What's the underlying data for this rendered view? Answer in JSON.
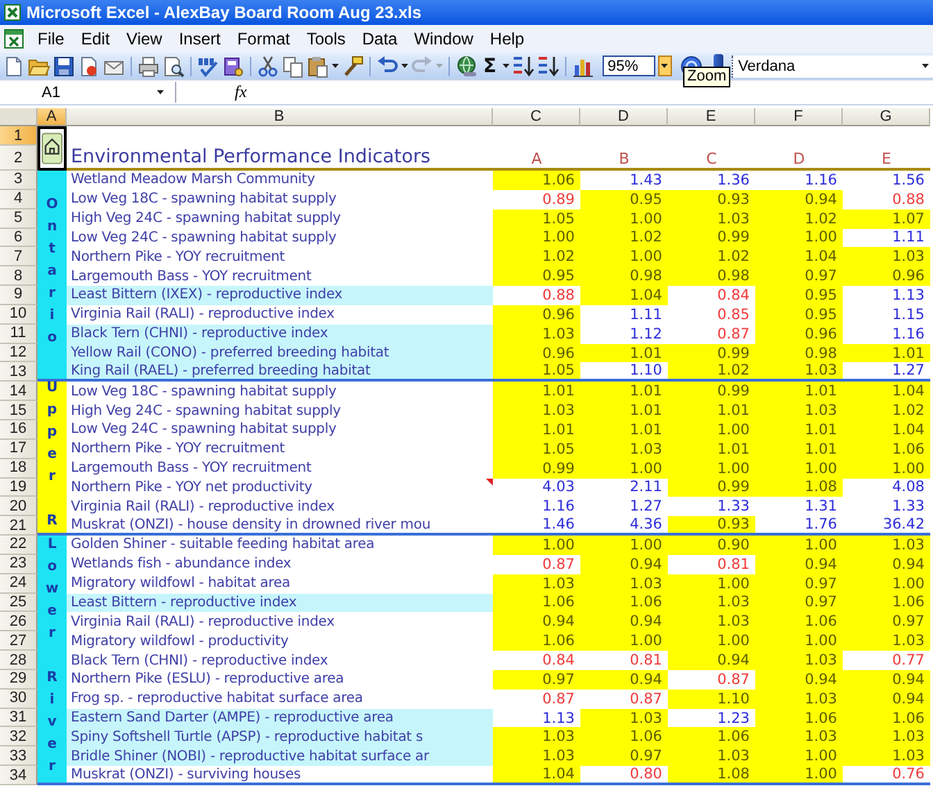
{
  "window": {
    "title": "Microsoft Excel - AlexBay Board Room Aug 23.xls"
  },
  "menu": [
    "File",
    "Edit",
    "View",
    "Insert",
    "Format",
    "Tools",
    "Data",
    "Window",
    "Help"
  ],
  "toolbar": {
    "sum_symbol": "Σ",
    "zoom": "95%",
    "tooltip": "Zoom",
    "font": "Verdana",
    "redo_disabled": true
  },
  "formula_bar": {
    "name_box": "A1",
    "function_label": "fx"
  },
  "sheet": {
    "columns": [
      {
        "label": "A",
        "selected": true
      },
      {
        "label": "B",
        "selected": false
      },
      {
        "label": "C",
        "selected": false
      },
      {
        "label": "D",
        "selected": false
      },
      {
        "label": "E",
        "selected": false
      },
      {
        "label": "F",
        "selected": false
      },
      {
        "label": "G",
        "selected": false
      }
    ],
    "header_rows": [
      {
        "n": "1",
        "selected": true
      },
      {
        "n": "2",
        "selected": false
      }
    ],
    "title": "Environmental Performance Indicators",
    "subheaders": [
      "A",
      "B",
      "C",
      "D",
      "E"
    ],
    "groups": [
      {
        "label": "Ontario",
        "color": "#1ee3f5",
        "rows": [
          {
            "n": "3",
            "selected": false,
            "label": "Wetland Meadow Marsh Community",
            "highlighted": false,
            "comment": false,
            "cells": [
              {
                "value": "1.06",
                "kind": "ok"
              },
              {
                "value": "1.43",
                "kind": "high"
              },
              {
                "value": "1.36",
                "kind": "high"
              },
              {
                "value": "1.16",
                "kind": "high"
              },
              {
                "value": "1.56",
                "kind": "high"
              }
            ]
          },
          {
            "n": "4",
            "selected": false,
            "label": "Low Veg 18C - spawning habitat supply",
            "highlighted": false,
            "comment": false,
            "cells": [
              {
                "value": "0.89",
                "kind": "low"
              },
              {
                "value": "0.95",
                "kind": "ok"
              },
              {
                "value": "0.93",
                "kind": "ok"
              },
              {
                "value": "0.94",
                "kind": "ok"
              },
              {
                "value": "0.88",
                "kind": "low"
              }
            ]
          },
          {
            "n": "5",
            "selected": false,
            "label": "High Veg 24C - spawning habitat supply",
            "highlighted": false,
            "comment": false,
            "cells": [
              {
                "value": "1.05",
                "kind": "ok"
              },
              {
                "value": "1.00",
                "kind": "ok"
              },
              {
                "value": "1.03",
                "kind": "ok"
              },
              {
                "value": "1.02",
                "kind": "ok"
              },
              {
                "value": "1.07",
                "kind": "ok"
              }
            ]
          },
          {
            "n": "6",
            "selected": false,
            "label": "Low Veg 24C - spawning habitat supply",
            "highlighted": false,
            "comment": false,
            "cells": [
              {
                "value": "1.00",
                "kind": "ok"
              },
              {
                "value": "1.02",
                "kind": "ok"
              },
              {
                "value": "0.99",
                "kind": "ok"
              },
              {
                "value": "1.00",
                "kind": "ok"
              },
              {
                "value": "1.11",
                "kind": "high"
              }
            ]
          },
          {
            "n": "7",
            "selected": false,
            "label": "Northern Pike - YOY recruitment",
            "highlighted": false,
            "comment": false,
            "cells": [
              {
                "value": "1.02",
                "kind": "ok"
              },
              {
                "value": "1.00",
                "kind": "ok"
              },
              {
                "value": "1.02",
                "kind": "ok"
              },
              {
                "value": "1.04",
                "kind": "ok"
              },
              {
                "value": "1.03",
                "kind": "ok"
              }
            ]
          },
          {
            "n": "8",
            "selected": false,
            "label": "Largemouth Bass - YOY recruitment",
            "highlighted": false,
            "comment": false,
            "cells": [
              {
                "value": "0.95",
                "kind": "ok"
              },
              {
                "value": "0.98",
                "kind": "ok"
              },
              {
                "value": "0.98",
                "kind": "ok"
              },
              {
                "value": "0.97",
                "kind": "ok"
              },
              {
                "value": "0.96",
                "kind": "ok"
              }
            ]
          },
          {
            "n": "9",
            "selected": false,
            "label": "Least Bittern (IXEX) - reproductive index",
            "highlighted": true,
            "comment": false,
            "cells": [
              {
                "value": "0.88",
                "kind": "low"
              },
              {
                "value": "1.04",
                "kind": "ok"
              },
              {
                "value": "0.84",
                "kind": "low"
              },
              {
                "value": "0.95",
                "kind": "ok"
              },
              {
                "value": "1.13",
                "kind": "high"
              }
            ]
          },
          {
            "n": "10",
            "selected": false,
            "label": "Virginia Rail (RALI) - reproductive index",
            "highlighted": false,
            "comment": false,
            "cells": [
              {
                "value": "0.96",
                "kind": "ok"
              },
              {
                "value": "1.11",
                "kind": "high"
              },
              {
                "value": "0.85",
                "kind": "low"
              },
              {
                "value": "0.95",
                "kind": "ok"
              },
              {
                "value": "1.15",
                "kind": "high"
              }
            ]
          },
          {
            "n": "11",
            "selected": false,
            "label": "Black Tern (CHNI) - reproductive index",
            "highlighted": true,
            "comment": false,
            "cells": [
              {
                "value": "1.03",
                "kind": "ok"
              },
              {
                "value": "1.12",
                "kind": "high"
              },
              {
                "value": "0.87",
                "kind": "low"
              },
              {
                "value": "0.96",
                "kind": "ok"
              },
              {
                "value": "1.16",
                "kind": "high"
              }
            ]
          },
          {
            "n": "12",
            "selected": false,
            "label": "Yellow Rail (CONO) - preferred breeding habitat",
            "highlighted": true,
            "comment": false,
            "cells": [
              {
                "value": "0.96",
                "kind": "ok"
              },
              {
                "value": "1.01",
                "kind": "ok"
              },
              {
                "value": "0.99",
                "kind": "ok"
              },
              {
                "value": "0.98",
                "kind": "ok"
              },
              {
                "value": "1.01",
                "kind": "ok"
              }
            ]
          },
          {
            "n": "13",
            "selected": false,
            "label": "King Rail (RAEL) - preferred breeding habitat",
            "highlighted": true,
            "comment": false,
            "cells": [
              {
                "value": "1.05",
                "kind": "ok"
              },
              {
                "value": "1.10",
                "kind": "high"
              },
              {
                "value": "1.02",
                "kind": "ok"
              },
              {
                "value": "1.03",
                "kind": "ok"
              },
              {
                "value": "1.27",
                "kind": "high"
              }
            ]
          }
        ]
      },
      {
        "label": "Upper R",
        "color": "#ffff00",
        "rows": [
          {
            "n": "14",
            "selected": false,
            "label": "Low Veg 18C - spawning habitat supply",
            "highlighted": false,
            "comment": false,
            "cells": [
              {
                "value": "1.01",
                "kind": "ok"
              },
              {
                "value": "1.01",
                "kind": "ok"
              },
              {
                "value": "0.99",
                "kind": "ok"
              },
              {
                "value": "1.01",
                "kind": "ok"
              },
              {
                "value": "1.04",
                "kind": "ok"
              }
            ]
          },
          {
            "n": "15",
            "selected": false,
            "label": "High Veg 24C - spawning habitat supply",
            "highlighted": false,
            "comment": false,
            "cells": [
              {
                "value": "1.03",
                "kind": "ok"
              },
              {
                "value": "1.01",
                "kind": "ok"
              },
              {
                "value": "1.01",
                "kind": "ok"
              },
              {
                "value": "1.03",
                "kind": "ok"
              },
              {
                "value": "1.02",
                "kind": "ok"
              }
            ]
          },
          {
            "n": "16",
            "selected": false,
            "label": "Low Veg 24C - spawning habitat supply",
            "highlighted": false,
            "comment": false,
            "cells": [
              {
                "value": "1.01",
                "kind": "ok"
              },
              {
                "value": "1.01",
                "kind": "ok"
              },
              {
                "value": "1.00",
                "kind": "ok"
              },
              {
                "value": "1.01",
                "kind": "ok"
              },
              {
                "value": "1.04",
                "kind": "ok"
              }
            ]
          },
          {
            "n": "17",
            "selected": false,
            "label": "Northern Pike - YOY recruitment",
            "highlighted": false,
            "comment": false,
            "cells": [
              {
                "value": "1.05",
                "kind": "ok"
              },
              {
                "value": "1.03",
                "kind": "ok"
              },
              {
                "value": "1.01",
                "kind": "ok"
              },
              {
                "value": "1.01",
                "kind": "ok"
              },
              {
                "value": "1.06",
                "kind": "ok"
              }
            ]
          },
          {
            "n": "18",
            "selected": false,
            "label": "Largemouth Bass - YOY recruitment",
            "highlighted": false,
            "comment": false,
            "cells": [
              {
                "value": "0.99",
                "kind": "ok"
              },
              {
                "value": "1.00",
                "kind": "ok"
              },
              {
                "value": "1.00",
                "kind": "ok"
              },
              {
                "value": "1.00",
                "kind": "ok"
              },
              {
                "value": "1.00",
                "kind": "ok"
              }
            ]
          },
          {
            "n": "19",
            "selected": false,
            "label": "Northern Pike - YOY net productivity",
            "highlighted": false,
            "comment": true,
            "cells": [
              {
                "value": "4.03",
                "kind": "high"
              },
              {
                "value": "2.11",
                "kind": "high"
              },
              {
                "value": "0.99",
                "kind": "ok"
              },
              {
                "value": "1.08",
                "kind": "ok"
              },
              {
                "value": "4.08",
                "kind": "high"
              }
            ]
          },
          {
            "n": "20",
            "selected": false,
            "label": "Virginia Rail (RALI) - reproductive index",
            "highlighted": false,
            "comment": false,
            "cells": [
              {
                "value": "1.16",
                "kind": "high"
              },
              {
                "value": "1.27",
                "kind": "high"
              },
              {
                "value": "1.33",
                "kind": "high"
              },
              {
                "value": "1.31",
                "kind": "high"
              },
              {
                "value": "1.33",
                "kind": "high"
              }
            ]
          },
          {
            "n": "21",
            "selected": false,
            "label": "Muskrat (ONZI) - house density in drowned river mou",
            "highlighted": false,
            "comment": false,
            "cells": [
              {
                "value": "1.46",
                "kind": "high"
              },
              {
                "value": "4.36",
                "kind": "high"
              },
              {
                "value": "0.93",
                "kind": "ok"
              },
              {
                "value": "1.76",
                "kind": "high"
              },
              {
                "value": "36.42",
                "kind": "high"
              }
            ]
          }
        ]
      },
      {
        "label": "Lower River",
        "color": "#1ee3f5",
        "rows": [
          {
            "n": "22",
            "selected": false,
            "label": "Golden Shiner - suitable feeding habitat area",
            "highlighted": false,
            "comment": false,
            "cells": [
              {
                "value": "1.00",
                "kind": "ok"
              },
              {
                "value": "1.00",
                "kind": "ok"
              },
              {
                "value": "0.90",
                "kind": "ok"
              },
              {
                "value": "1.00",
                "kind": "ok"
              },
              {
                "value": "1.03",
                "kind": "ok"
              }
            ]
          },
          {
            "n": "23",
            "selected": false,
            "label": "Wetlands fish - abundance index",
            "highlighted": false,
            "comment": false,
            "cells": [
              {
                "value": "0.87",
                "kind": "low"
              },
              {
                "value": "0.94",
                "kind": "ok"
              },
              {
                "value": "0.81",
                "kind": "low"
              },
              {
                "value": "0.94",
                "kind": "ok"
              },
              {
                "value": "0.94",
                "kind": "ok"
              }
            ]
          },
          {
            "n": "24",
            "selected": false,
            "label": "Migratory wildfowl - habitat area",
            "highlighted": false,
            "comment": false,
            "cells": [
              {
                "value": "1.03",
                "kind": "ok"
              },
              {
                "value": "1.03",
                "kind": "ok"
              },
              {
                "value": "1.00",
                "kind": "ok"
              },
              {
                "value": "0.97",
                "kind": "ok"
              },
              {
                "value": "1.00",
                "kind": "ok"
              }
            ]
          },
          {
            "n": "25",
            "selected": false,
            "label": "Least Bittern - reproductive index",
            "highlighted": true,
            "comment": false,
            "cells": [
              {
                "value": "1.06",
                "kind": "ok"
              },
              {
                "value": "1.06",
                "kind": "ok"
              },
              {
                "value": "1.03",
                "kind": "ok"
              },
              {
                "value": "0.97",
                "kind": "ok"
              },
              {
                "value": "1.06",
                "kind": "ok"
              }
            ]
          },
          {
            "n": "26",
            "selected": false,
            "label": "Virginia Rail (RALI) - reproductive index",
            "highlighted": false,
            "comment": false,
            "cells": [
              {
                "value": "0.94",
                "kind": "ok"
              },
              {
                "value": "0.94",
                "kind": "ok"
              },
              {
                "value": "1.03",
                "kind": "ok"
              },
              {
                "value": "1.06",
                "kind": "ok"
              },
              {
                "value": "0.97",
                "kind": "ok"
              }
            ]
          },
          {
            "n": "27",
            "selected": false,
            "label": "Migratory wildfowl - productivity",
            "highlighted": false,
            "comment": false,
            "cells": [
              {
                "value": "1.06",
                "kind": "ok"
              },
              {
                "value": "1.00",
                "kind": "ok"
              },
              {
                "value": "1.00",
                "kind": "ok"
              },
              {
                "value": "1.00",
                "kind": "ok"
              },
              {
                "value": "1.03",
                "kind": "ok"
              }
            ]
          },
          {
            "n": "28",
            "selected": false,
            "label": "Black Tern (CHNI) - reproductive index",
            "highlighted": false,
            "comment": false,
            "cells": [
              {
                "value": "0.84",
                "kind": "low"
              },
              {
                "value": "0.81",
                "kind": "low"
              },
              {
                "value": "0.94",
                "kind": "ok"
              },
              {
                "value": "1.03",
                "kind": "ok"
              },
              {
                "value": "0.77",
                "kind": "low"
              }
            ]
          },
          {
            "n": "29",
            "selected": false,
            "label": "Northern Pike (ESLU) - reproductive area",
            "highlighted": false,
            "comment": false,
            "cells": [
              {
                "value": "0.97",
                "kind": "ok"
              },
              {
                "value": "0.94",
                "kind": "ok"
              },
              {
                "value": "0.87",
                "kind": "low"
              },
              {
                "value": "0.94",
                "kind": "ok"
              },
              {
                "value": "0.94",
                "kind": "ok"
              }
            ]
          },
          {
            "n": "30",
            "selected": false,
            "label": "Frog sp. - reproductive habitat surface area",
            "highlighted": false,
            "comment": false,
            "cells": [
              {
                "value": "0.87",
                "kind": "low"
              },
              {
                "value": "0.87",
                "kind": "low"
              },
              {
                "value": "1.10",
                "kind": "ok"
              },
              {
                "value": "1.03",
                "kind": "ok"
              },
              {
                "value": "0.94",
                "kind": "ok"
              }
            ]
          },
          {
            "n": "31",
            "selected": false,
            "label": "Eastern Sand Darter (AMPE) - reproductive area",
            "highlighted": true,
            "comment": false,
            "cells": [
              {
                "value": "1.13",
                "kind": "high"
              },
              {
                "value": "1.03",
                "kind": "ok"
              },
              {
                "value": "1.23",
                "kind": "high"
              },
              {
                "value": "1.06",
                "kind": "ok"
              },
              {
                "value": "1.06",
                "kind": "ok"
              }
            ]
          },
          {
            "n": "32",
            "selected": false,
            "label": "Spiny Softshell Turtle (APSP) - reproductive habitat s",
            "highlighted": true,
            "comment": false,
            "cells": [
              {
                "value": "1.03",
                "kind": "ok"
              },
              {
                "value": "1.06",
                "kind": "ok"
              },
              {
                "value": "1.06",
                "kind": "ok"
              },
              {
                "value": "1.03",
                "kind": "ok"
              },
              {
                "value": "1.03",
                "kind": "ok"
              }
            ]
          },
          {
            "n": "33",
            "selected": false,
            "label": "Bridle Shiner (NOBI) - reproductive habitat surface ar",
            "highlighted": true,
            "comment": false,
            "cells": [
              {
                "value": "1.03",
                "kind": "ok"
              },
              {
                "value": "0.97",
                "kind": "ok"
              },
              {
                "value": "1.03",
                "kind": "ok"
              },
              {
                "value": "1.00",
                "kind": "ok"
              },
              {
                "value": "1.03",
                "kind": "ok"
              }
            ]
          },
          {
            "n": "34",
            "selected": false,
            "label": "Muskrat (ONZI) - surviving houses",
            "highlighted": false,
            "comment": false,
            "cells": [
              {
                "value": "1.04",
                "kind": "ok"
              },
              {
                "value": "0.80",
                "kind": "low"
              },
              {
                "value": "1.08",
                "kind": "ok"
              },
              {
                "value": "1.00",
                "kind": "ok"
              },
              {
                "value": "0.76",
                "kind": "low"
              }
            ]
          }
        ]
      }
    ]
  }
}
